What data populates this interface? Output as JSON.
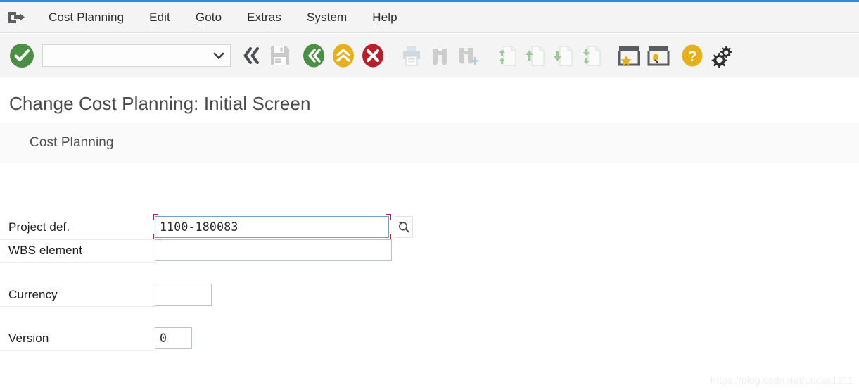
{
  "window": {
    "accent_color": "#2e8ccf"
  },
  "menubar": {
    "logo_icon": "exit-pointer-icon",
    "items": [
      {
        "label": "Cost Planning",
        "accel_index": 5
      },
      {
        "label": "Edit",
        "accel_index": 1
      },
      {
        "label": "Goto",
        "accel_index": 0
      },
      {
        "label": "Extras",
        "accel_index": 4
      },
      {
        "label": "System",
        "accel_index": 1
      },
      {
        "label": "Help",
        "accel_index": 0
      }
    ]
  },
  "toolbar": {
    "command_field": {
      "value": "",
      "placeholder": "",
      "dropdown_icon": "chevron-down-icon"
    },
    "buttons": [
      {
        "name": "enter-button",
        "icon": "green-check-circle-icon",
        "tooltip": "Enter",
        "enabled": true,
        "color": "#3f8b3f"
      },
      {
        "name": "command-back-button",
        "icon": "double-chevron-left-icon",
        "tooltip": "Back",
        "enabled": true,
        "color": "#53565a"
      },
      {
        "name": "save-button",
        "icon": "floppy-disk-icon",
        "tooltip": "Save",
        "enabled": false,
        "color": "#c9c9c9"
      },
      {
        "name": "back-button",
        "icon": "green-back-circle-icon",
        "tooltip": "Back",
        "enabled": true,
        "color": "#3f8b3f"
      },
      {
        "name": "exit-button",
        "icon": "yellow-up-circle-icon",
        "tooltip": "Exit",
        "enabled": true,
        "color": "#e8b21e"
      },
      {
        "name": "cancel-button",
        "icon": "red-x-circle-icon",
        "tooltip": "Cancel",
        "enabled": true,
        "color": "#b81f2d"
      },
      {
        "name": "print-button",
        "icon": "printer-icon",
        "tooltip": "Print",
        "enabled": false,
        "color": "#d6dde2"
      },
      {
        "name": "find-button",
        "icon": "binoculars-icon",
        "tooltip": "Find",
        "enabled": false,
        "color": "#cdcdcd"
      },
      {
        "name": "find-next-button",
        "icon": "binoculars-plus-icon",
        "tooltip": "Find Next",
        "enabled": false,
        "color": "#cdcdcd"
      },
      {
        "name": "first-page-button",
        "icon": "page-first-icon",
        "tooltip": "First Page",
        "enabled": false,
        "color": "#cfe3cf"
      },
      {
        "name": "previous-page-button",
        "icon": "page-previous-icon",
        "tooltip": "Previous Page",
        "enabled": false,
        "color": "#cfe3cf"
      },
      {
        "name": "next-page-button",
        "icon": "page-next-icon",
        "tooltip": "Next Page",
        "enabled": false,
        "color": "#cfe3cf"
      },
      {
        "name": "last-page-button",
        "icon": "page-last-icon",
        "tooltip": "Last Page",
        "enabled": false,
        "color": "#cfe3cf"
      },
      {
        "name": "favorites-button",
        "icon": "window-star-icon",
        "tooltip": "Create Shortcut",
        "enabled": true,
        "color": "#5a5d60"
      },
      {
        "name": "customize-button",
        "icon": "window-hand-icon",
        "tooltip": "Customize",
        "enabled": true,
        "color": "#5a5d60"
      },
      {
        "name": "help-button",
        "icon": "question-circle-icon",
        "tooltip": "Help",
        "enabled": true,
        "color": "#e8b21e"
      },
      {
        "name": "settings-button",
        "icon": "gear-icon",
        "tooltip": "Customize Layout",
        "enabled": true,
        "color": "#2f2f2f"
      }
    ]
  },
  "header": {
    "title": "Change Cost Planning: Initial Screen",
    "section_label": "Cost Planning"
  },
  "form": {
    "fields": [
      {
        "name": "project-def",
        "label": "Project def.",
        "value": "1100-180083",
        "focused": true,
        "has_f4_help": true,
        "f4_icon": "search-magnifier-icon"
      },
      {
        "name": "wbs-element",
        "label": "WBS element",
        "value": "",
        "focused": false,
        "has_f4_help": false
      },
      {
        "name": "currency",
        "label": "Currency",
        "value": "",
        "focused": false,
        "has_f4_help": false
      },
      {
        "name": "version",
        "label": "Version",
        "value": "0",
        "focused": false,
        "has_f4_help": false
      }
    ]
  },
  "watermark": {
    "text": "https://blog.csdn.net/Lucas1211"
  }
}
